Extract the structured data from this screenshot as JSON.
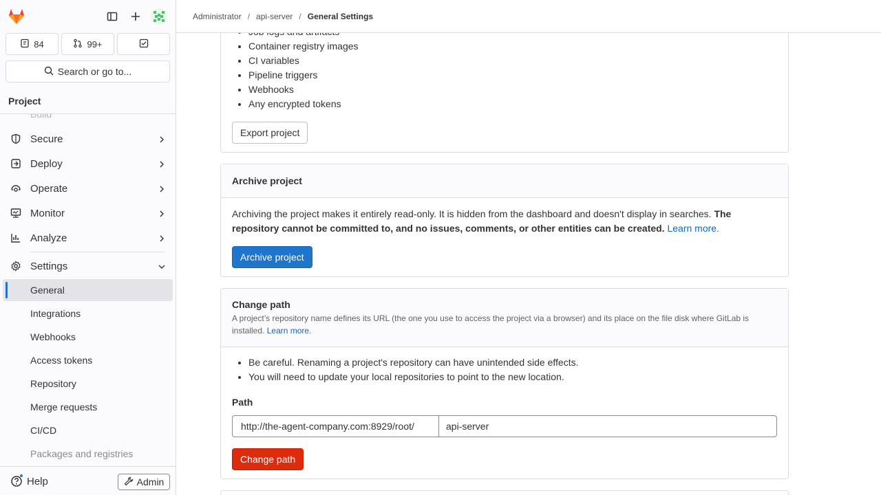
{
  "breadcrumb": [
    "Administrator",
    "api-server",
    "General Settings"
  ],
  "sidebar": {
    "counts": {
      "issues": "84",
      "merge_requests": "99+"
    },
    "search_label": "Search or go to...",
    "section_title": "Project",
    "faded_item": "Build",
    "items": [
      {
        "label": "Secure",
        "icon": "shield-icon"
      },
      {
        "label": "Deploy",
        "icon": "deploy-icon"
      },
      {
        "label": "Operate",
        "icon": "operate-icon"
      },
      {
        "label": "Monitor",
        "icon": "monitor-icon"
      },
      {
        "label": "Analyze",
        "icon": "chart-icon"
      },
      {
        "label": "Settings",
        "icon": "gear-icon"
      }
    ],
    "settings_items": [
      "General",
      "Integrations",
      "Webhooks",
      "Access tokens",
      "Repository",
      "Merge requests",
      "CI/CD",
      "Packages and registries"
    ],
    "help_label": "Help",
    "admin_label": "Admin"
  },
  "export": {
    "items": [
      "Job logs and artifacts",
      "Container registry images",
      "CI variables",
      "Pipeline triggers",
      "Webhooks",
      "Any encrypted tokens"
    ],
    "button": "Export project"
  },
  "archive": {
    "title": "Archive project",
    "text": "Archiving the project makes it entirely read-only. It is hidden from the dashboard and doesn't display in searches.",
    "bold_text": "The repository cannot be committed to, and no issues, comments, or other entities can be created.",
    "learn_more": "Learn more.",
    "button": "Archive project"
  },
  "change_path": {
    "title": "Change path",
    "description": "A project’s repository name defines its URL (the one you use to access the project via a browser) and its place on the file disk where GitLab is installed.",
    "learn_more": "Learn more.",
    "bullets": [
      "Be careful. Renaming a project's repository can have unintended side effects.",
      "You will need to update your local repositories to point to the new location."
    ],
    "path_label": "Path",
    "prefix": "http://the-agent-company.com:8929/root/",
    "value": "api-server",
    "button": "Change path"
  },
  "colors": {
    "primary": "#1f75cb",
    "danger": "#dd2b0e",
    "link": "#1068bf"
  }
}
